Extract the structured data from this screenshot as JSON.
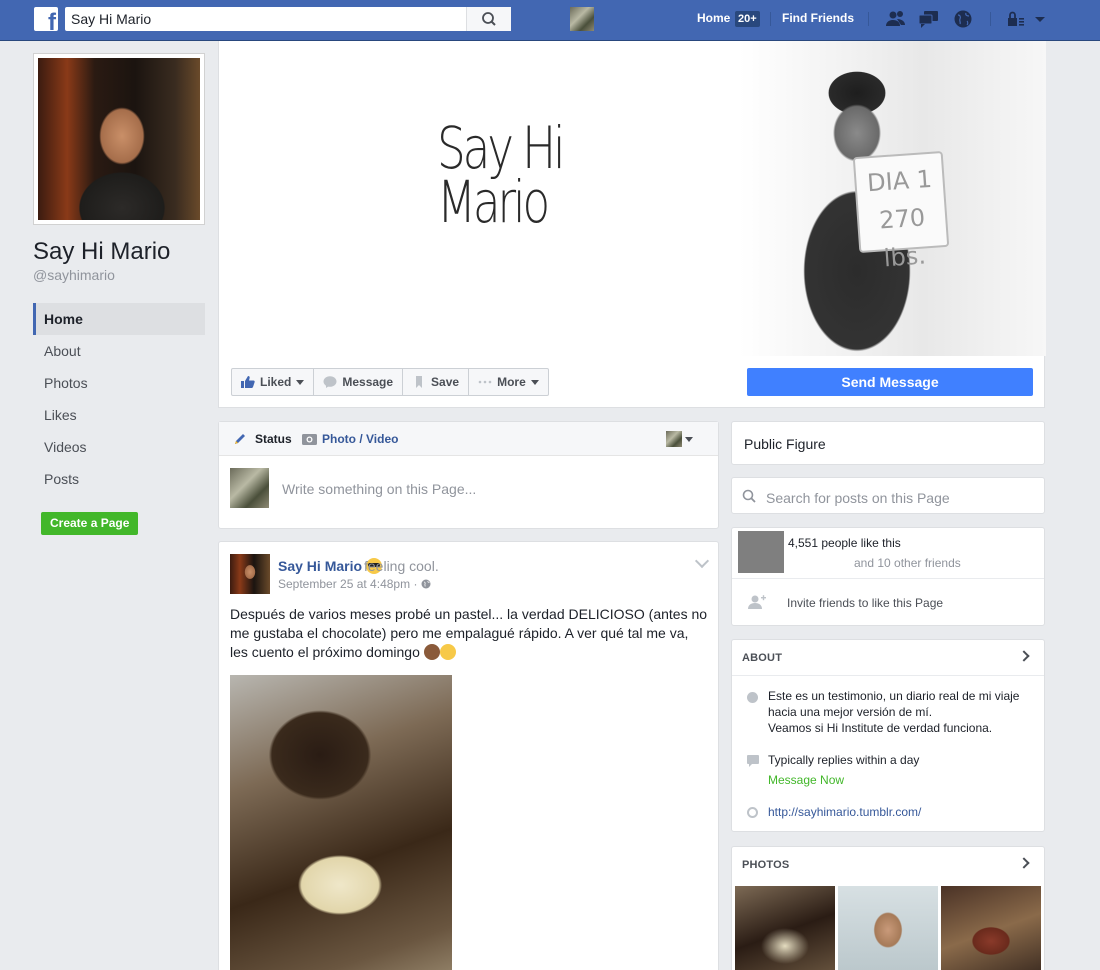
{
  "topbar": {
    "search_value": "Say Hi Mario",
    "home_label": "Home",
    "home_badge": "20+",
    "find_friends_label": "Find Friends"
  },
  "profile": {
    "name": "Say Hi Mario",
    "handle": "@sayhimario"
  },
  "sidebar": {
    "items": [
      {
        "label": "Home"
      },
      {
        "label": "About"
      },
      {
        "label": "Photos"
      },
      {
        "label": "Likes"
      },
      {
        "label": "Videos"
      },
      {
        "label": "Posts"
      }
    ],
    "create_page_label": "Create a Page"
  },
  "cover": {
    "title_line1": "Say Hi",
    "title_line2": "Mario",
    "sign_line1": "DIA 1",
    "sign_line2": "270 lbs."
  },
  "actions": {
    "liked_label": "Liked",
    "message_label": "Message",
    "save_label": "Save",
    "more_label": "More",
    "send_message_label": "Send Message"
  },
  "composer": {
    "status_label": "Status",
    "photo_video_label": "Photo / Video",
    "placeholder": "Write something on this Page..."
  },
  "post": {
    "author": "Say Hi Mario",
    "feeling": "feeling cool.",
    "date": "September 25 at 4:48pm",
    "text": "Después de varios meses probé un pastel... la verdad DELICIOSO (antes no me gustaba el chocolate) pero me empalagué rápido. A ver qué tal me va, les cuento el próximo domingo"
  },
  "right": {
    "category": "Public Figure",
    "search_placeholder": "Search for posts on this Page",
    "likes_count": "4,551 people like this",
    "likes_friends": "and 10 other friends",
    "invite_label": "Invite friends to like this Page",
    "about_heading": "ABOUT",
    "about_line1": "Este es un testimonio, un diario real de mi viaje hacia una mejor versión de mí.",
    "about_line2": "Veamos si Hi Institute de verdad funciona.",
    "replies": "Typically replies within a day",
    "message_now": "Message Now",
    "url": "http://sayhimario.tumblr.com/",
    "photos_heading": "PHOTOS"
  },
  "colors": {
    "brand_blue": "#4267b2",
    "send_message_blue": "#4080ff",
    "create_page_green": "#42b72a",
    "link_blue": "#365899"
  }
}
